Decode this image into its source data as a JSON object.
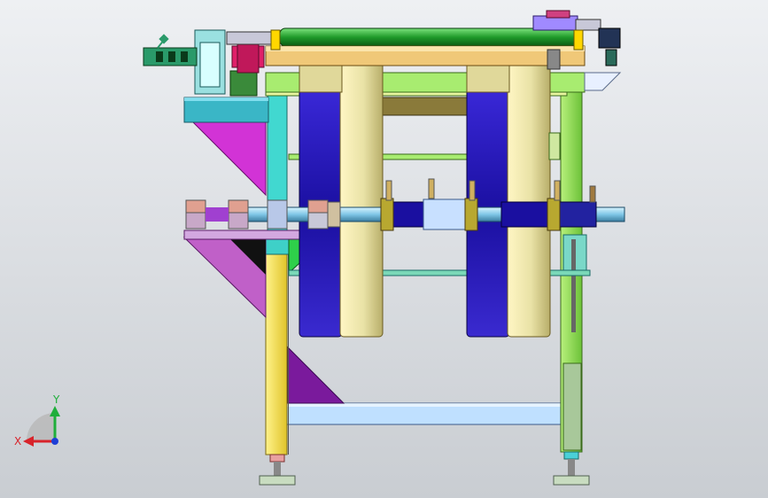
{
  "view": {
    "background_top": "#eef0f3",
    "background_bottom": "#c9cdd2"
  },
  "triad": {
    "x_label": "X",
    "y_label": "Y",
    "x_color": "#d8232a",
    "y_color": "#1fae3b",
    "z_color": "#1e3ed6"
  },
  "palette": {
    "roller_rail": "#1f9a2a",
    "blue_drum": "#1a0fa0",
    "cream_drum": "#e9e2a6",
    "frame_green": "#a8ec70",
    "magenta_plate": "#d233d6",
    "yellow_leg": "#f3e04a",
    "cyan_beam": "#bfe8ff"
  }
}
